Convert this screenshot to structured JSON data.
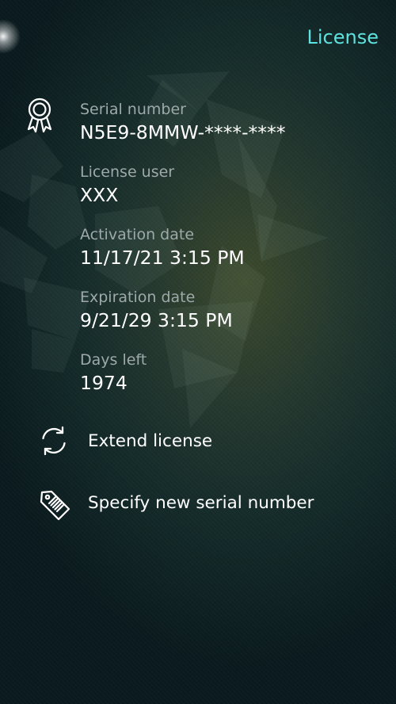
{
  "header": {
    "title": "License"
  },
  "license": {
    "fields": [
      {
        "label": "Serial number",
        "value": "N5E9-8MMW-****-****"
      },
      {
        "label": "License user",
        "value": "XXX"
      },
      {
        "label": "Activation date",
        "value": "11/17/21 3:15 PM"
      },
      {
        "label": "Expiration date",
        "value": "9/21/29 3:15 PM"
      },
      {
        "label": "Days left",
        "value": "1974"
      }
    ]
  },
  "actions": {
    "extend_label": "Extend license",
    "new_serial_label": "Specify new serial number"
  },
  "colors": {
    "accent": "#5ee2df",
    "label": "#9ea9aa",
    "value": "#ffffff"
  },
  "icons": {
    "license": "award-ribbon-icon",
    "extend": "refresh-icon",
    "serial": "tag-icon"
  }
}
